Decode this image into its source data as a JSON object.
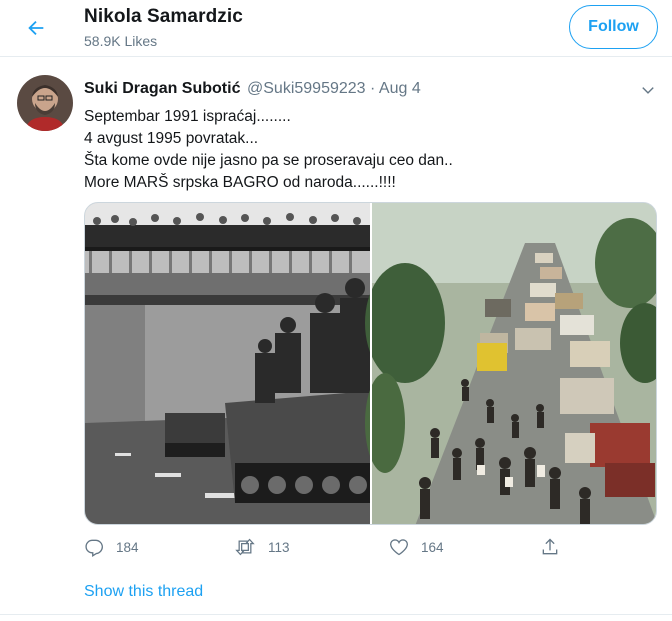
{
  "header": {
    "title": "Nikola Samardzic",
    "likes": "58.9K Likes",
    "follow_label": "Follow"
  },
  "tweet": {
    "author_name": "Suki Dragan Subotić",
    "author_handle": "@Suki59959223",
    "date": "· Aug 4",
    "lines": [
      "Septembar 1991 ispraćaj........",
      "4 avgust 1995 povratak...",
      "Šta kome ovde nije jasno pa se proseravaju ceo dan..",
      "More MARŠ srpska BAGRO od naroda......!!!!"
    ],
    "media": {
      "left_image_icon": "photo-tanks-bridge",
      "right_image_icon": "photo-refugee-column"
    },
    "actions": {
      "reply_count": "184",
      "retweet_count": "113",
      "like_count": "164",
      "reply_icon": "reply-icon",
      "retweet_icon": "retweet-icon",
      "like_icon": "heart-icon",
      "share_icon": "share-icon"
    },
    "show_thread": "Show this thread"
  },
  "colors": {
    "accent": "#1da1f2",
    "secondary_text": "#657786",
    "border": "#e6ecf0"
  }
}
